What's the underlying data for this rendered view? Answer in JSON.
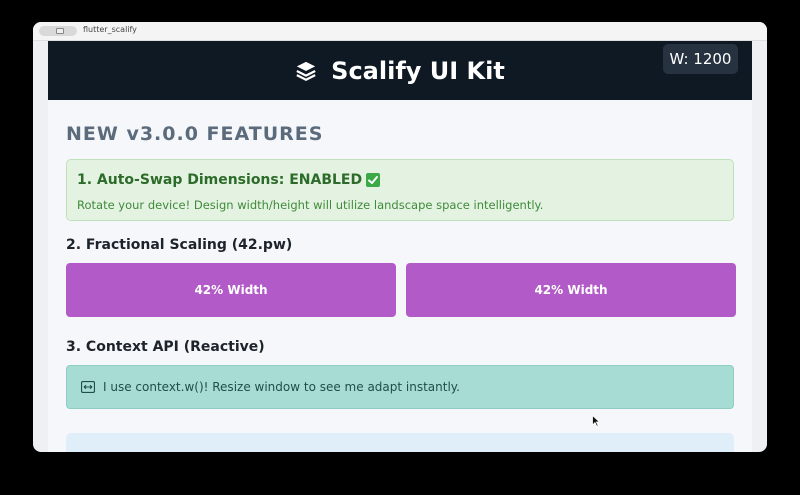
{
  "window": {
    "title": "flutter_scalify"
  },
  "appbar": {
    "title": "Scalify UI Kit",
    "width_badge": "W: 1200",
    "icon": "layers-icon"
  },
  "features": {
    "heading": "NEW v3.0.0 FEATURES",
    "auto_swap": {
      "title": "1. Auto-Swap Dimensions: ENABLED",
      "icon": "check-mark-icon",
      "description": "Rotate your device! Design width/height will utilize landscape space intelligently."
    },
    "fractional": {
      "title": "2. Fractional Scaling (42.pw)",
      "boxes": [
        {
          "label": "42% Width"
        },
        {
          "label": "42% Width"
        }
      ]
    },
    "context": {
      "title": "3. Context API (Reactive)",
      "icon": "resize-icon",
      "message": "I use context.w()! Resize window to see me adapt instantly."
    }
  },
  "colors": {
    "appbar_bg": "#0f1923",
    "success_bg": "#e4f3e1",
    "success_text": "#2d6b2a",
    "purple_box": "#b25ac8",
    "teal_card": "#a7dcd4",
    "heading": "#5b6b7c"
  }
}
